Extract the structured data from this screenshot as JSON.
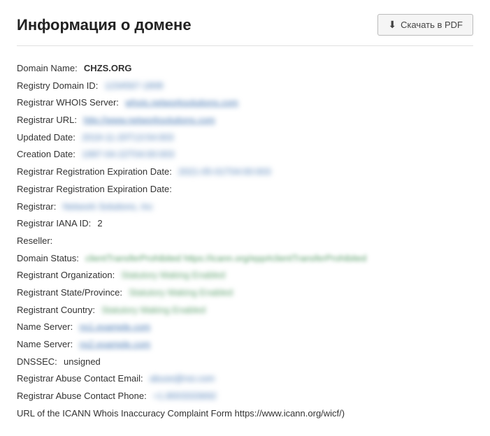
{
  "header": {
    "title": "Информация о домене",
    "download_button": "Скачать в PDF"
  },
  "fields": [
    {
      "label": "Domain Name:  ",
      "value": "CHZS.ORG",
      "style": "domain-name"
    },
    {
      "label": "Registry Domain ID:  ",
      "value": "1234567-1808",
      "style": "blurred"
    },
    {
      "label": "Registrar WHOIS Server:  ",
      "value": "whois.networksolutions.com",
      "style": "link-style"
    },
    {
      "label": "Registrar URL:  ",
      "value": "http://www.networksolutions.com",
      "style": "link-style"
    },
    {
      "label": "Updated Date:  ",
      "value": "2019-11-20T13:54:003",
      "style": "blurred"
    },
    {
      "label": "Creation Date:  ",
      "value": "1997-04-22T04:00:003",
      "style": "blurred"
    },
    {
      "label": "Registrar Registration Expiration Date:  ",
      "value": "2021-05-01T04:00:003",
      "style": "blurred"
    },
    {
      "label": "Registrar Registration Expiration Date:  ",
      "value": "",
      "style": "plain"
    },
    {
      "label": "Registrar:  ",
      "value": "Network Solutions, Inc",
      "style": "blurred"
    },
    {
      "label": "Registrar IANA ID:  ",
      "value": "2",
      "style": "plain"
    },
    {
      "label": "Reseller:  ",
      "value": "",
      "style": "plain"
    },
    {
      "label": "Domain Status:  ",
      "value": "clientTransferProhibited https://icann.org/epp#clientTransferProhibited",
      "style": "status-blurred"
    },
    {
      "label": "Registrant Organization:  ",
      "value": "Statutory Making Enabled",
      "style": "redacted"
    },
    {
      "label": "Registrant State/Province:  ",
      "value": "Statutory Making Enabled",
      "style": "redacted"
    },
    {
      "label": "Registrant Country:  ",
      "value": "Statutory Making Enabled",
      "style": "redacted"
    },
    {
      "label": "Name Server:  ",
      "value": "ns1.example.com",
      "style": "link-style"
    },
    {
      "label": "Name Server:  ",
      "value": "ns2.example.com",
      "style": "link-style"
    },
    {
      "label": "DNSSEC:  ",
      "value": "unsigned",
      "style": "plain"
    },
    {
      "label": "Registrar Abuse Contact Email:  ",
      "value": "abuse@nsi.com",
      "style": "blurred"
    },
    {
      "label": "Registrar Abuse Contact Phone:  ",
      "value": "+1.8003333692",
      "style": "blurred"
    },
    {
      "label": "URL of the ICANN Whois Inaccuracy Complaint Form https://www.icann.org/wicf/)",
      "value": "",
      "style": "plain"
    }
  ]
}
